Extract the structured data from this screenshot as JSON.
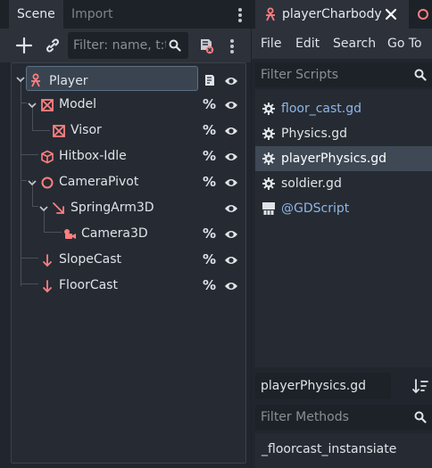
{
  "scene_dock": {
    "tabs": [
      {
        "label": "Scene",
        "active": true
      },
      {
        "label": "Import",
        "active": false
      }
    ],
    "toolbar": {
      "add_icon": "plus-icon",
      "link_icon": "link-icon",
      "filter_placeholder": "Filter: name, t:t",
      "search_icon": "search-icon",
      "script_icon": "script-remove-icon",
      "menu_icon": "kebab-menu-icon"
    },
    "tree": [
      {
        "label": "Player",
        "icon": "character-body-icon",
        "depth": 0,
        "expanded": true,
        "selected": true,
        "script": true,
        "visible": true
      },
      {
        "label": "Model",
        "icon": "node3d-icon",
        "depth": 1,
        "expanded": true,
        "pct": "%",
        "visible": true
      },
      {
        "label": "Visor",
        "icon": "node3d-icon",
        "depth": 2,
        "pct": "%",
        "visible": true
      },
      {
        "label": "Hitbox-Idle",
        "icon": "collision-shape-icon",
        "depth": 1,
        "pct": "%",
        "visible": true
      },
      {
        "label": "CameraPivot",
        "icon": "node-circle-icon",
        "depth": 1,
        "expanded": true,
        "pct": "%",
        "visible": true
      },
      {
        "label": "SpringArm3D",
        "icon": "spring-arm-icon",
        "depth": 2,
        "expanded": true,
        "visible": true
      },
      {
        "label": "Camera3D",
        "icon": "camera-icon",
        "depth": 3,
        "pct": "%",
        "visible": true
      },
      {
        "label": "SlopeCast",
        "icon": "raycast-icon",
        "depth": 1,
        "pct": "%",
        "visible": true
      },
      {
        "label": "FloorCast",
        "icon": "raycast-icon",
        "depth": 1,
        "pct": "%",
        "visible": true
      }
    ]
  },
  "script_dock": {
    "active_tab": "playerCharbody",
    "menu": [
      "File",
      "Edit",
      "Search",
      "Go To"
    ],
    "filter_scripts_placeholder": "Filter Scripts",
    "scripts": [
      {
        "label": "floor_cast.gd",
        "icon": "gear-icon",
        "color": "#8fb5e6",
        "selected": false
      },
      {
        "label": "Physics.gd",
        "icon": "gear-icon",
        "color": "#dfe3e8",
        "selected": false
      },
      {
        "label": "playerPhysics.gd",
        "icon": "gear-icon",
        "color": "#ffffff",
        "selected": true
      },
      {
        "label": "soldier.gd",
        "icon": "gear-icon",
        "color": "#dfe3e8",
        "selected": false
      },
      {
        "label": "@GDScript",
        "icon": "doc-icon",
        "color": "#8fb5e6",
        "selected": false
      }
    ],
    "current_script": "playerPhysics.gd",
    "filter_methods_placeholder": "Filter Methods",
    "methods": [
      "_floorcast_instansiate"
    ]
  },
  "colors": {
    "accent_red": "#fc7f7f",
    "selection": "#3a4451",
    "link_blue": "#8fb5e6"
  }
}
